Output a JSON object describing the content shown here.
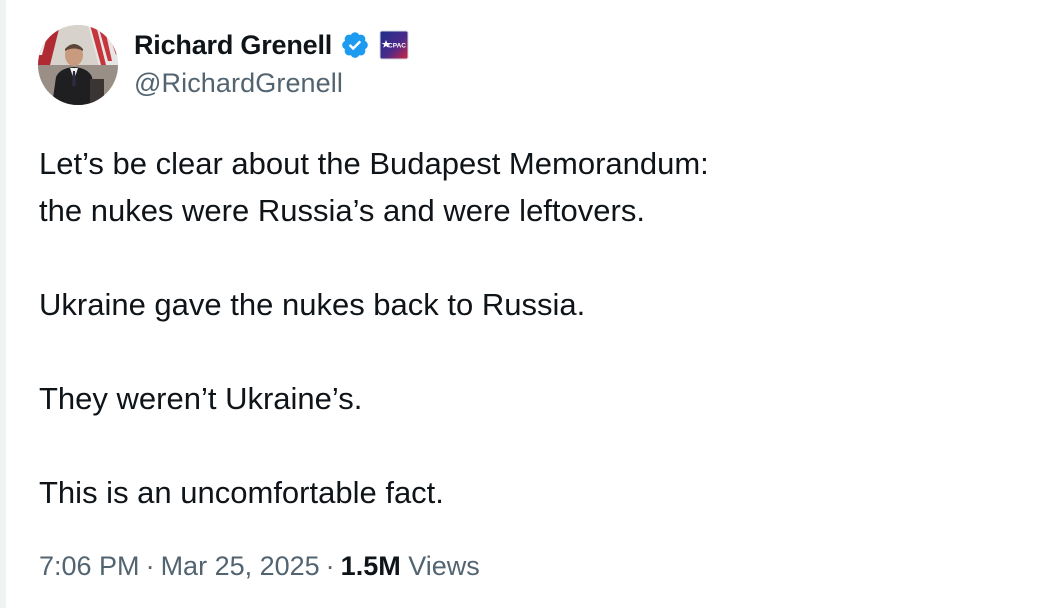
{
  "author": {
    "display_name": "Richard Grenell",
    "handle": "@RichardGrenell",
    "verified_icon": "verified-badge-icon",
    "affiliation_icon": "cpac-badge-icon",
    "affiliation_badge_text": "CPAC",
    "brand_color": "#1d9bf0"
  },
  "tweet": {
    "paragraphs": [
      "Let’s be clear about the Budapest Memorandum:",
      "the nukes were Russia’s and were leftovers.",
      "Ukraine gave the nukes back to Russia.",
      "They weren’t Ukraine’s.",
      "This is an uncomfortable fact."
    ]
  },
  "meta": {
    "time": "7:06 PM",
    "separator": "·",
    "date": "Mar 25, 2025",
    "views_count": "1.5M",
    "views_label": "Views"
  },
  "colors": {
    "text": "#0f1419",
    "secondary_text": "#536471",
    "verified_blue": "#1d9bf0"
  }
}
